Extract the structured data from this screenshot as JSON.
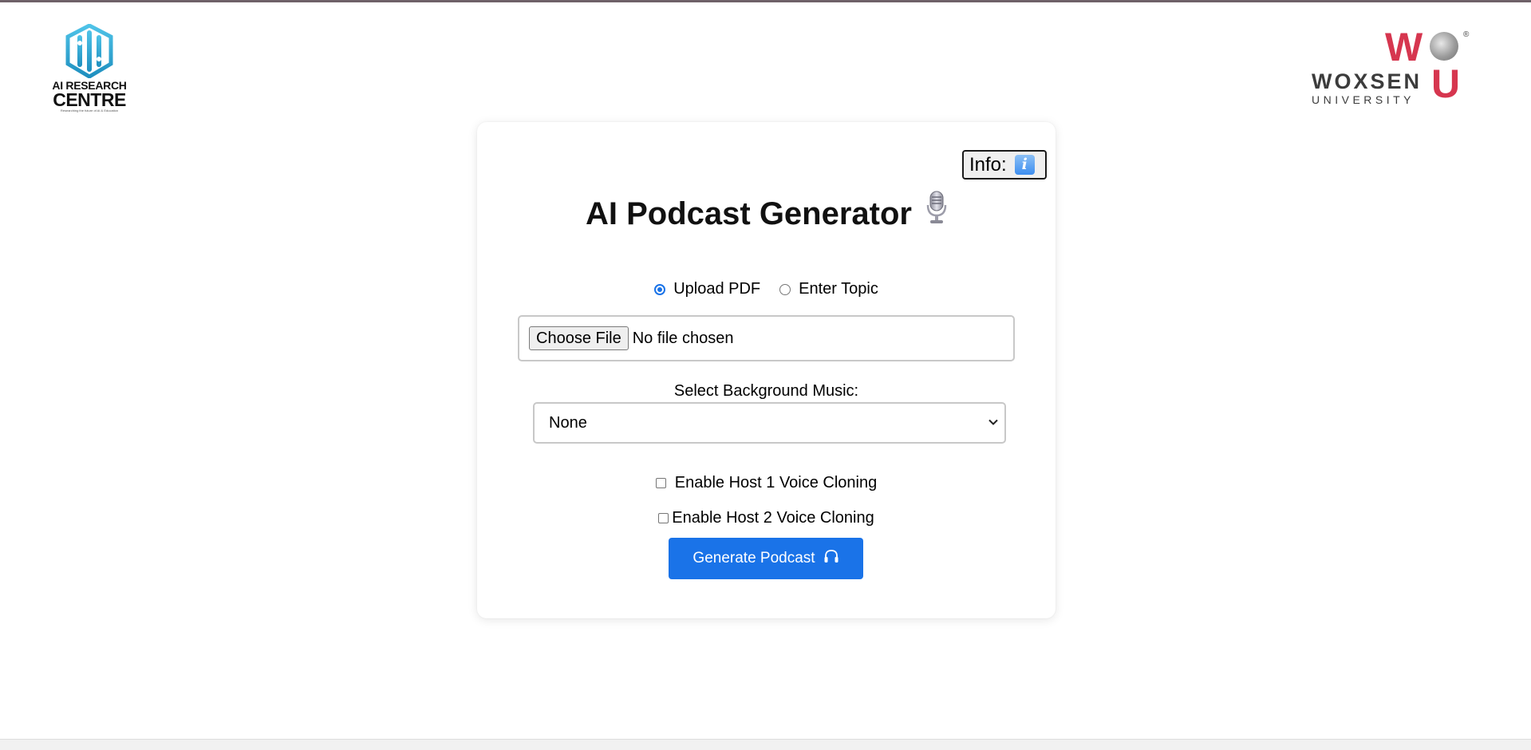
{
  "logos": {
    "left": {
      "line1": "AI RESEARCH",
      "line2": "CENTRE",
      "tagline": "Researching the future of AI & Education"
    },
    "right": {
      "mark_w": "W",
      "mark_u": "U",
      "registered": "®",
      "name": "WOXSEN",
      "subname": "UNIVERSITY"
    }
  },
  "card": {
    "info_button_label": "Info:",
    "info_icon": "info-icon",
    "title": "AI Podcast Generator",
    "title_icon": "microphone-icon",
    "source_options": [
      {
        "label": "Upload PDF",
        "selected": true
      },
      {
        "label": "Enter Topic",
        "selected": false
      }
    ],
    "file_input": {
      "button_label": "Choose File",
      "status": "No file chosen"
    },
    "music": {
      "label": "Select Background Music:",
      "selected": "None"
    },
    "checkboxes": [
      {
        "label": "Enable Host 1 Voice Cloning",
        "checked": false
      },
      {
        "label": "Enable Host 2 Voice Cloning",
        "checked": false
      }
    ],
    "generate_button": {
      "label": "Generate Podcast",
      "icon": "headphones-icon"
    }
  },
  "colors": {
    "accent": "#1a73e8",
    "brand_red": "#d6364f",
    "logo_teal": "#2aa6cf"
  }
}
